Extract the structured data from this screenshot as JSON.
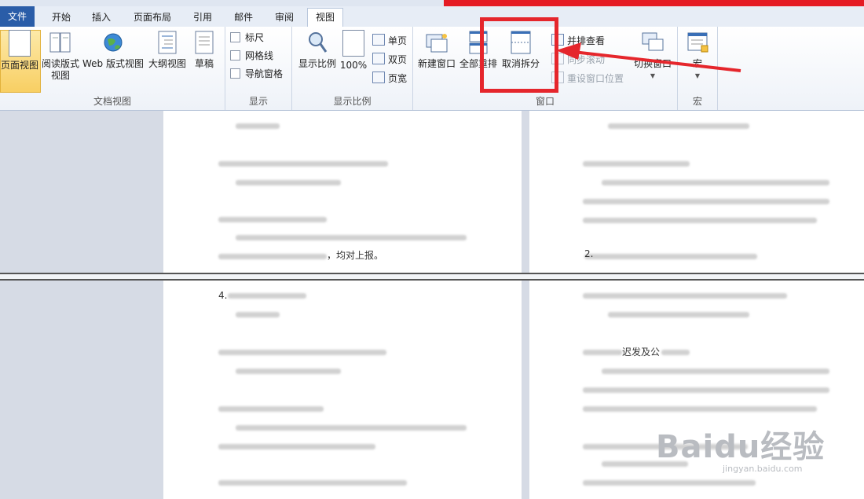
{
  "tabs": {
    "file": "文件",
    "home": "开始",
    "insert": "插入",
    "layout": "页面布局",
    "references": "引用",
    "mailings": "邮件",
    "review": "审阅",
    "view": "视图"
  },
  "ribbon": {
    "doc_views": {
      "label": "文档视图",
      "print_layout": "页面视图",
      "full_reading_1": "阅读版式",
      "full_reading_2": "视图",
      "web_layout": "Web 版式视图",
      "outline": "大纲视图",
      "draft": "草稿"
    },
    "show": {
      "label": "显示",
      "ruler": "标尺",
      "gridlines": "网格线",
      "nav_pane": "导航窗格"
    },
    "zoom": {
      "label": "显示比例",
      "zoom": "显示比例",
      "hundred": "100%",
      "one_page": "单页",
      "two_pages": "双页",
      "page_width": "页宽"
    },
    "window": {
      "label": "窗口",
      "new_window": "新建窗口",
      "arrange_all": "全部重排",
      "remove_split": "取消拆分",
      "side_by_side": "并排查看",
      "sync_scroll": "同步滚动",
      "reset_position": "重设窗口位置",
      "switch_windows": "切换窗口"
    },
    "macros": {
      "label": "宏",
      "macros": "宏"
    }
  },
  "document": {
    "visible_text_1": "，均对上报。",
    "visible_text_2": "4.",
    "visible_text_3": "2.",
    "visible_text_4": "迟发及公"
  },
  "watermark": {
    "brand": "Baidu经验",
    "url": "jingyan.baidu.com"
  },
  "colors": {
    "file_tab": "#2a5da8",
    "highlight_box": "#e5262c",
    "arrow": "#e5262c",
    "active_button": "#f8cf63"
  }
}
